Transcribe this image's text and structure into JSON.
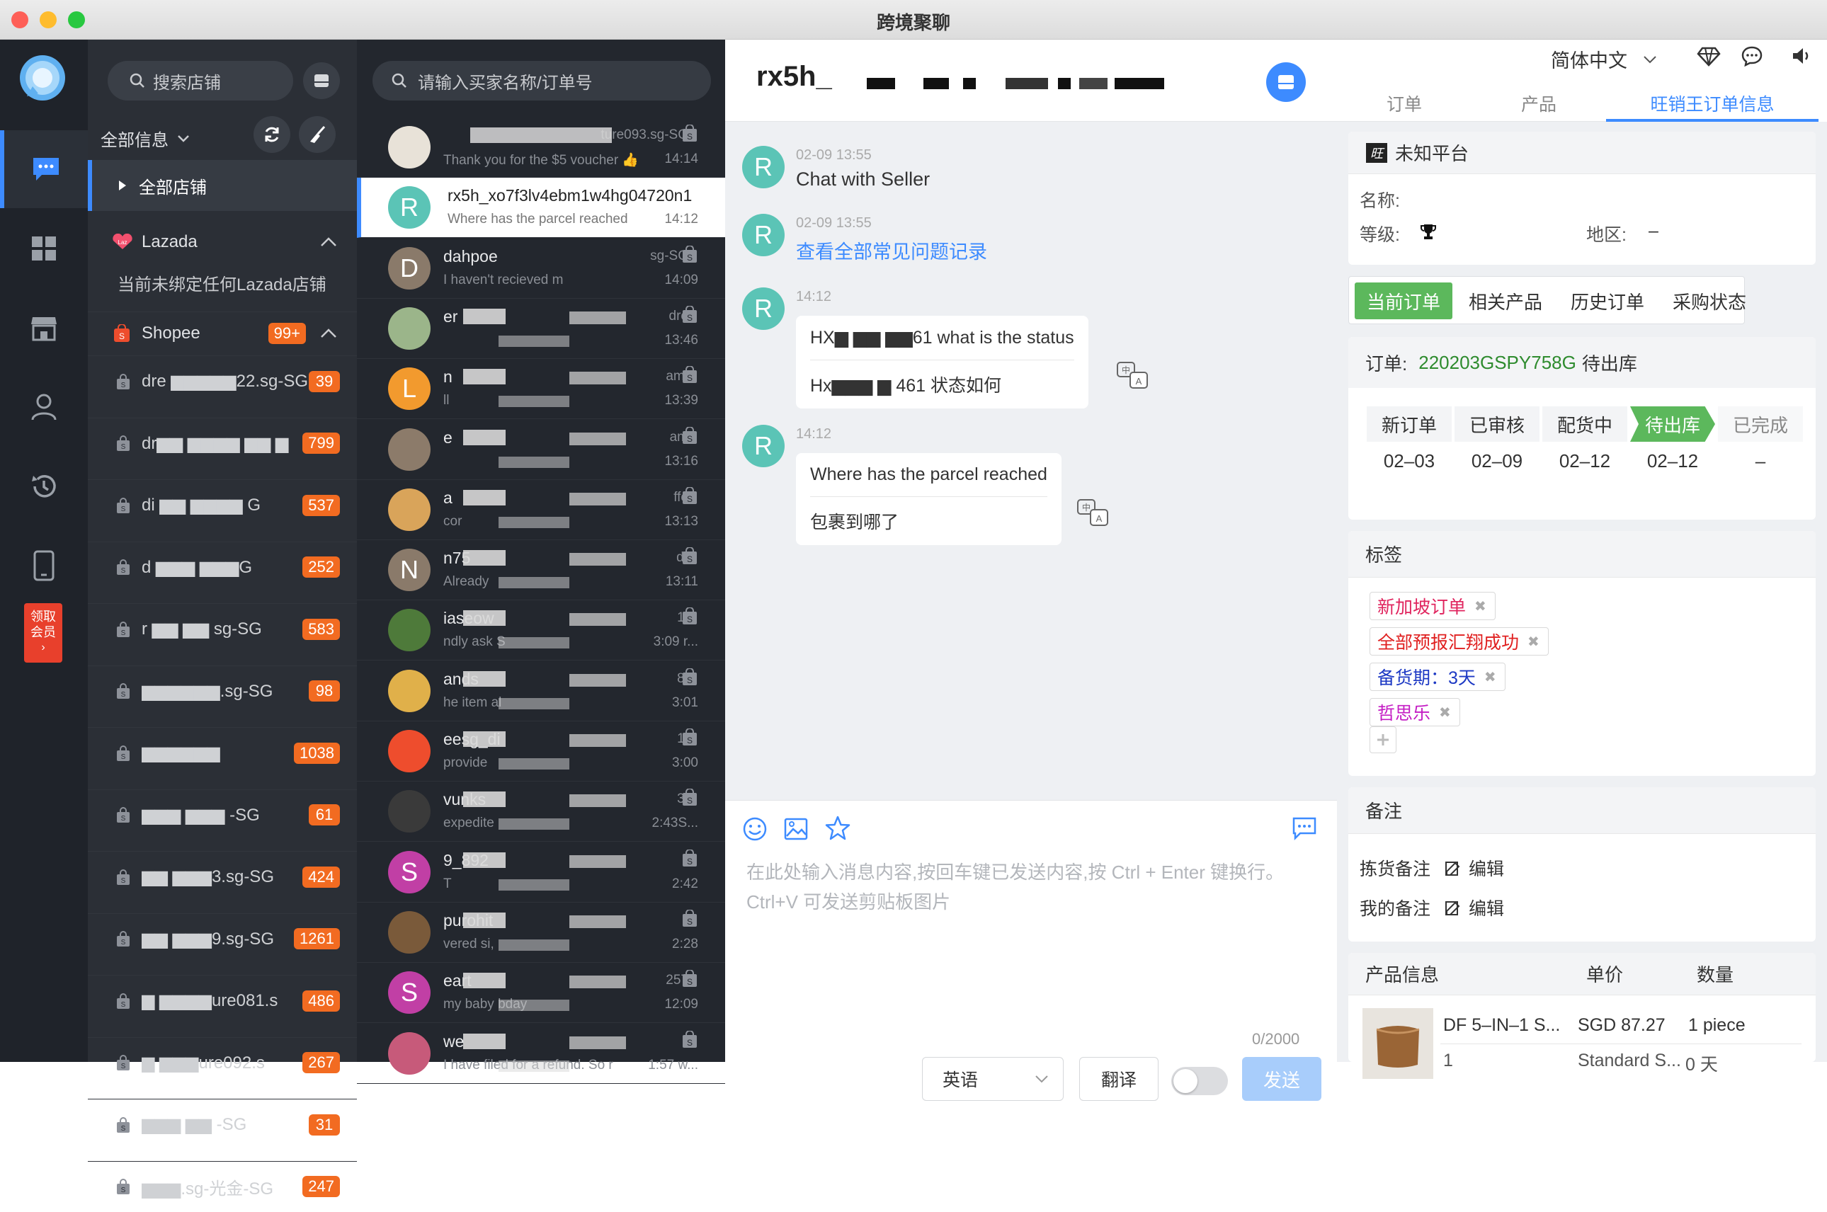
{
  "window": {
    "title": "跨境聚聊"
  },
  "rail": {
    "vip_line1": "领取",
    "vip_line2": "会员"
  },
  "stores": {
    "search_placeholder": "搜索店铺",
    "filter_label": "全部信息",
    "all_stores_label": "全部店铺",
    "lazada": {
      "label": "Lazada",
      "empty_text": "当前未绑定任何Lazada店铺"
    },
    "shopee": {
      "label": "Shopee",
      "badge": "99+"
    },
    "items": [
      {
        "name": "dre ▆▆▆▆▆22.sg-SG",
        "badge": "39"
      },
      {
        "name": "dr▆▆ ▆▆▆▆ ▆▆ ▆",
        "badge": "799"
      },
      {
        "name": "di ▆▆ ▆▆▆▆ G",
        "badge": "537"
      },
      {
        "name": "d ▆▆▆ ▆▆▆G",
        "badge": "252"
      },
      {
        "name": "r ▆▆ ▆▆ sg-SG",
        "badge": "583"
      },
      {
        "name": "▆▆▆▆▆▆.sg-SG",
        "badge": "98"
      },
      {
        "name": "▆▆▆▆▆▆",
        "badge": "1038"
      },
      {
        "name": "▆▆▆ ▆▆▆ -SG",
        "badge": "61"
      },
      {
        "name": "▆▆ ▆▆▆3.sg-SG",
        "badge": "424"
      },
      {
        "name": "▆▆ ▆▆▆9.sg-SG",
        "badge": "1261"
      },
      {
        "name": "▆ ▆▆▆▆ure081.s",
        "badge": "486"
      },
      {
        "name": "▆ ▆▆▆ure092.s",
        "badge": "267"
      },
      {
        "name": "▆▆▆ ▆▆ -SG",
        "badge": "31"
      },
      {
        "name": "▆▆▆.sg-光金-SG",
        "badge": "247"
      }
    ]
  },
  "chats": {
    "search_placeholder": "请输入买家名称/订单号",
    "items": [
      {
        "initial": "",
        "name": "",
        "shop": "ture093.sg-SG",
        "msg": "Thank you for the $5 voucher 👍",
        "time": "14:14",
        "color": "#e8e2d8"
      },
      {
        "initial": "R",
        "name": "rx5h_xo7f3lv4ebm1w4hg04720n1",
        "shop": "",
        "msg": "Where has the parcel reached",
        "time": "14:12",
        "color": "#5bc4b6"
      },
      {
        "initial": "D",
        "name": "dahpoe",
        "shop": "sg-SG",
        "msg": "I haven't recieved m",
        "time": "14:09",
        "color": "#8a7a6a"
      },
      {
        "initial": "",
        "name": "er",
        "shop": "dre",
        "msg": "",
        "time": "13:46",
        "color": "#9bb58a"
      },
      {
        "initial": "L",
        "name": "n",
        "shop": "amf",
        "msg": "ll",
        "time": "13:39",
        "color": "#f29a2e"
      },
      {
        "initial": "",
        "name": "e",
        "shop": "am",
        "msg": "",
        "time": "13:16",
        "color": "#8c7b6a"
      },
      {
        "initial": "",
        "name": "a",
        "shop": "ffe",
        "msg": "cor",
        "time": "13:13",
        "color": "#d9a45a"
      },
      {
        "initial": "N",
        "name": "n75",
        "shop": "dr",
        "msg": "Already",
        "time": "13:11",
        "color": "#8a7a6a"
      },
      {
        "initial": "",
        "name": "iaseow",
        "shop": "1.",
        "msg": "ndly ask S",
        "time": "3:09 r...",
        "color": "#4e7a3a"
      },
      {
        "initial": "",
        "name": "ands",
        "shop": "8.",
        "msg": "he item al",
        "time": "3:01",
        "color": "#e0b04a"
      },
      {
        "initial": "",
        "name": "eesg_di",
        "shop": "1.",
        "msg": "provide",
        "time": "3:00",
        "color": "#ee4d2d"
      },
      {
        "initial": "",
        "name": "vunks",
        "shop": "3.",
        "msg": "expedite",
        "time": "2:43S...",
        "color": "#3a3a3a"
      },
      {
        "initial": "S",
        "name": "9_892",
        "shop": "",
        "msg": "T",
        "time": "2:42",
        "color": "#c13fa5"
      },
      {
        "initial": "",
        "name": "purohit",
        "shop": "",
        "msg": "vered si,",
        "time": "2:28",
        "color": "#7a5a3a"
      },
      {
        "initial": "S",
        "name": "eart",
        "shop": "257",
        "msg": "my baby bday",
        "time": "12:09",
        "color": "#c13fa5"
      },
      {
        "initial": "",
        "name": "we",
        "shop": "",
        "msg": "I have filed for a refund. So r",
        "time": "1:57 w...",
        "color": "#c75a7a"
      }
    ]
  },
  "conversation": {
    "header_name": "rx5h_",
    "messages": [
      {
        "time": "02-09 13:55",
        "text": "Chat with Seller"
      },
      {
        "time": "02-09 13:55",
        "text": "查看全部常见问题记录"
      },
      {
        "time": "14:12",
        "original": "HX▆ ▆▆ ▆▆61 what is the status",
        "translated": "Hx▆▆▆ ▆ 461 状态如何"
      },
      {
        "time": "14:12",
        "original": "Where has the parcel reached",
        "translated": "包裹到哪了"
      }
    ],
    "composer": {
      "placeholder": "在此处输入消息内容,按回车键已发送内容,按 Ctrl + Enter 键换行。Ctrl+V 可发送剪贴板图片",
      "counter": "0/2000",
      "language": "英语",
      "translate_label": "翻译",
      "send_label": "发送"
    }
  },
  "right": {
    "language": "简体中文",
    "tabs": [
      "订单",
      "产品",
      "旺销王订单信息"
    ],
    "platform": {
      "title": "未知平台",
      "name_label": "名称:",
      "level_label": "等级:",
      "region_label": "地区:",
      "region_value": "–"
    },
    "subtabs": [
      "当前订单",
      "相关产品",
      "历史订单",
      "采购状态"
    ],
    "order": {
      "label": "订单:",
      "number": "220203GSPY758G",
      "status": "待出库"
    },
    "steps": [
      {
        "label": "新订单",
        "date": "02–03"
      },
      {
        "label": "已审核",
        "date": "02–09"
      },
      {
        "label": "配货中",
        "date": "02–12"
      },
      {
        "label": "待出库",
        "date": "02–12"
      },
      {
        "label": "已完成",
        "date": "–"
      }
    ],
    "tags_title": "标签",
    "tags": [
      {
        "text": "新加坡订单",
        "color": "#e0245e"
      },
      {
        "text": "全部预报汇翔成功",
        "color": "#e02020"
      },
      {
        "text": "备货期：3天",
        "color": "#1d39c4"
      },
      {
        "text": "哲思乐",
        "color": "#c41dc4"
      }
    ],
    "notes_title": "备注",
    "notes": [
      {
        "label": "拣货备注",
        "edit": "编辑"
      },
      {
        "label": "我的备注",
        "edit": "编辑"
      }
    ],
    "product": {
      "title": "产品信息",
      "price_header": "单价",
      "qty_header": "数量",
      "name": "DF 5–IN–1 S...",
      "price": "SGD 87.27",
      "qty": "1 piece",
      "line2_a": "1",
      "line2_b": "Standard S...",
      "line2_c": "0 天"
    }
  },
  "colors": {
    "accent": "#3d8bff",
    "green": "#5cb85c",
    "orange": "#f26b21",
    "teal": "#5bc4b6"
  }
}
